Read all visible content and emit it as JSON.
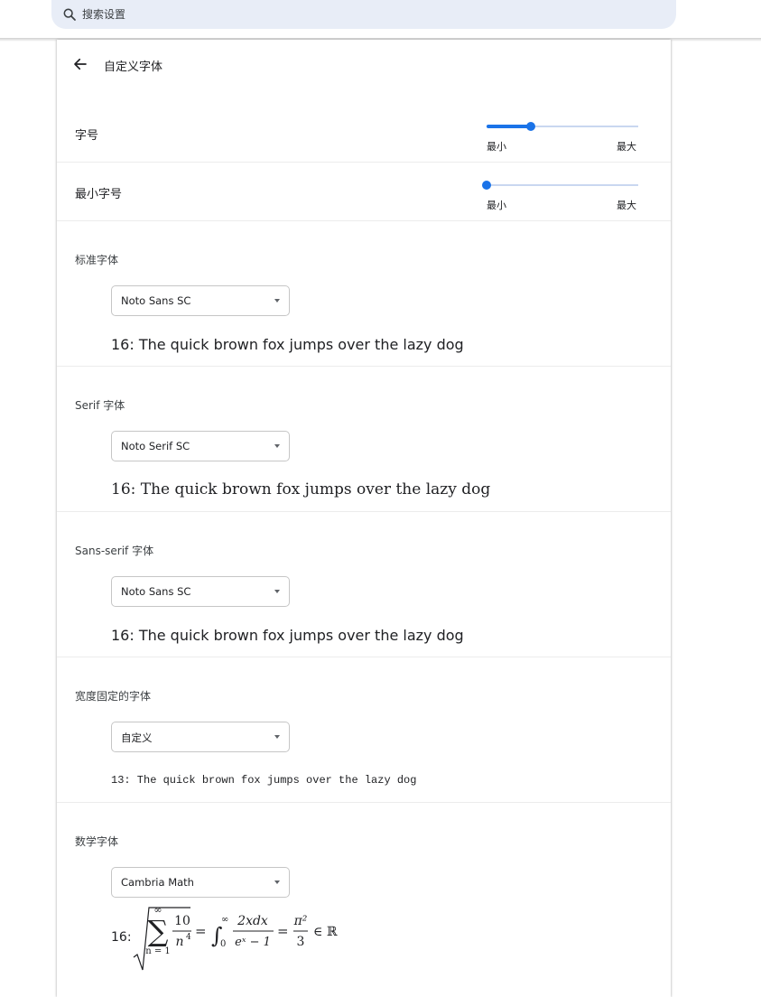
{
  "search": {
    "placeholder": "搜索设置"
  },
  "page": {
    "title": "自定义字体"
  },
  "font_size": {
    "label": "字号",
    "min_label": "最小",
    "max_label": "最大",
    "value_fraction": 0.29
  },
  "min_font_size": {
    "label": "最小字号",
    "min_label": "最小",
    "max_label": "最大",
    "value_fraction": 0.0
  },
  "fonts": [
    {
      "label": "标准字体",
      "selected": "Noto Sans SC",
      "sample": "16: The quick brown fox jumps over the lazy dog"
    },
    {
      "label": "Serif 字体",
      "selected": "Noto Serif SC",
      "sample": "16: The quick brown fox jumps over the lazy dog"
    },
    {
      "label": "Sans-serif 字体",
      "selected": "Noto Sans SC",
      "sample": "16: The quick brown fox jumps over the lazy dog"
    },
    {
      "label": "宽度固定的字体",
      "selected": "自定义",
      "sample": "13: The quick brown fox jumps over the lazy dog"
    }
  ],
  "math_font": {
    "label": "数学字体",
    "selected": "Cambria Math",
    "sample_prefix": "16:",
    "formula": {
      "sum_upper": "∞",
      "sum_lower": "n = 1",
      "numerator": "10",
      "denominator_base": "n",
      "denominator_exp": "4",
      "eq1": "=",
      "int_lower": "0",
      "int_upper": "∞",
      "int_numerator": "2xdx",
      "int_denominator": "eˣ − 1",
      "eq2": "=",
      "result_numerator": "π²",
      "result_denominator": "3",
      "member": "∈ ℝ"
    }
  }
}
